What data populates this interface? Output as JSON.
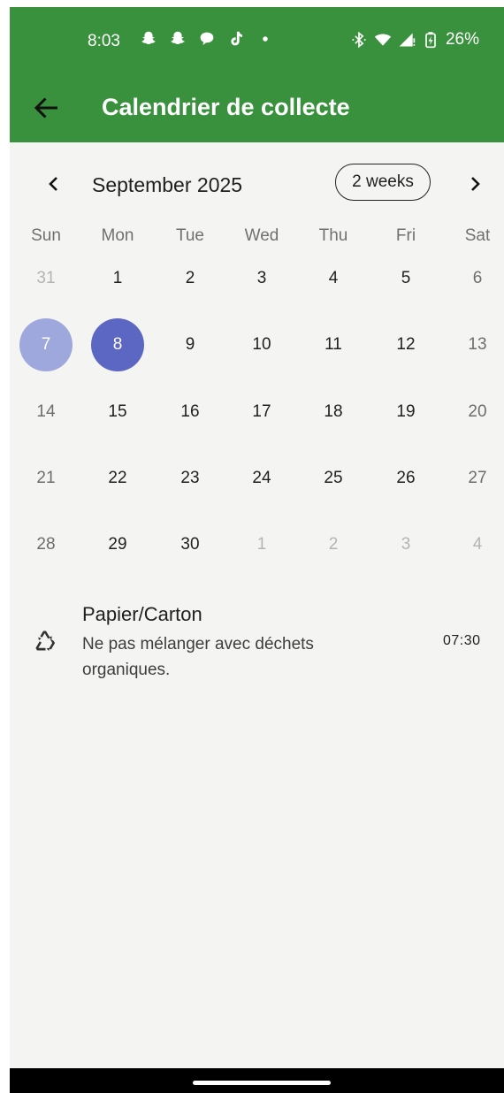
{
  "colors": {
    "app_green": "#3a913d",
    "background": "#f4f5f3",
    "selected_day_light": "#9ea8dc",
    "selected_day_dark": "#5b67c2"
  },
  "status_bar": {
    "time": "8:03",
    "battery": "26%",
    "notification_icons": [
      "snapchat-icon",
      "snapchat-icon",
      "chat-bubble-icon",
      "tiktok-icon",
      "dot-icon"
    ],
    "system_icons": [
      "bluetooth-icon",
      "wifi-icon",
      "signal-icon",
      "battery-charging-icon"
    ]
  },
  "app_bar": {
    "title": "Calendrier de collecte",
    "back_icon": "arrow-back-icon"
  },
  "calendar": {
    "month_title": "September 2025",
    "format_button": "2 weeks",
    "weekdays": [
      "Sun",
      "Mon",
      "Tue",
      "Wed",
      "Thu",
      "Fri",
      "Sat"
    ],
    "weeks": [
      [
        "31",
        "1",
        "2",
        "3",
        "4",
        "5",
        "6"
      ],
      [
        "7",
        "8",
        "9",
        "10",
        "11",
        "12",
        "13"
      ],
      [
        "14",
        "15",
        "16",
        "17",
        "18",
        "19",
        "20"
      ],
      [
        "21",
        "22",
        "23",
        "24",
        "25",
        "26",
        "27"
      ],
      [
        "28",
        "29",
        "30",
        "1",
        "2",
        "3",
        "4"
      ]
    ],
    "selected_day": "8",
    "highlighted_day": "7"
  },
  "events": [
    {
      "title": "Papier/Carton",
      "description": "Ne pas mélanger avec déchets organiques.",
      "time": "07:30",
      "icon": "recycle-icon"
    }
  ]
}
